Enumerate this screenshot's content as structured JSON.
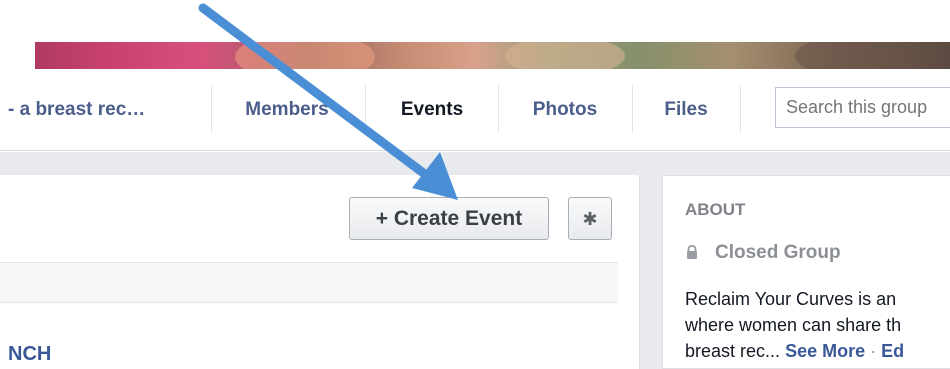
{
  "nav": {
    "group_name": "- a breast rec…",
    "tabs": [
      "Members",
      "Events",
      "Photos",
      "Files"
    ],
    "active_tab": "Events",
    "search_placeholder": "Search this group"
  },
  "main": {
    "create_event_label": "+ Create Event",
    "settings_icon": "gear-icon",
    "event_title": "NCH"
  },
  "about": {
    "heading": "ABOUT",
    "privacy": "Closed Group",
    "privacy_icon": "lock-icon",
    "description_lines": [
      "Reclaim Your Curves is an",
      "where women can share th",
      "breast rec..."
    ],
    "see_more": "See More",
    "separator": " · ",
    "edit": "Ed"
  },
  "colors": {
    "link": "#3b5998",
    "nav_link": "#4b5e8b",
    "arrow": "#4a8fd6",
    "page_bg": "#e9eaed"
  }
}
